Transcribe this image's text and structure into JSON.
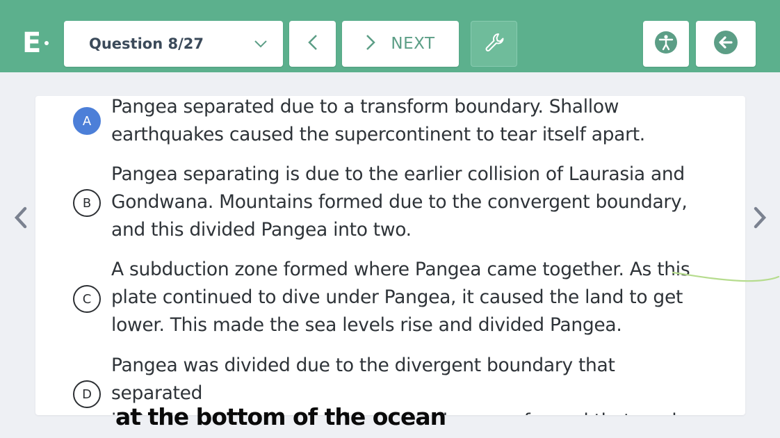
{
  "header": {
    "logo_text": "E",
    "question_select": {
      "value": "Question 8/27"
    },
    "next_label": "NEXT",
    "colors": {
      "bar": "#5cb08d",
      "button_icon": "#5c9e86",
      "selected_option": "#4c7fd8"
    },
    "icons": [
      "chevron-down-icon",
      "chevron-left-icon",
      "chevron-right-icon",
      "wrench-icon",
      "accessibility-icon",
      "exit-arrow-icon"
    ]
  },
  "options": [
    {
      "letter": "A",
      "selected": true,
      "lines": [
        "Pangea separated due to a transform boundary. Shallow",
        "earthquakes caused the supercontinent to tear itself apart."
      ]
    },
    {
      "letter": "B",
      "selected": false,
      "lines": [
        "Pangea separating is due to the earlier collision of Laurasia and",
        "Gondwana. Mountains formed due to the convergent boundary,",
        "and this divided Pangea into two."
      ]
    },
    {
      "letter": "C",
      "selected": false,
      "lines": [
        "A subduction zone formed where Pangea came together. As this",
        "plate continued to dive under Pangea, it caused the land to get",
        "lower. This made the sea levels rise and divided Pangea."
      ]
    },
    {
      "letter": "D",
      "selected": false,
      "lines": [
        "Pangea was divided due to the divergent boundary that separated",
        "it. As the boundary spread, new seafloor was formed that made"
      ]
    }
  ],
  "annotation": {
    "handwritten_text": "at the bottom of the ocean"
  }
}
